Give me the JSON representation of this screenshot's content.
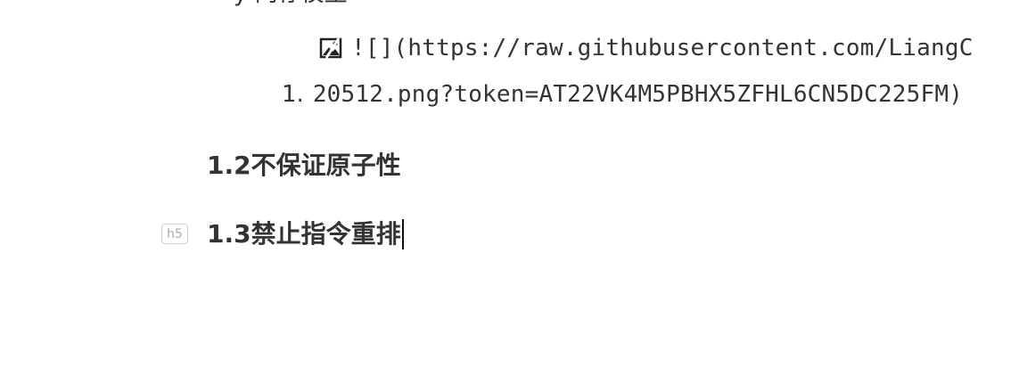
{
  "document": {
    "clipped_line_text": "y    内存模型",
    "image_markdown": "![](https://raw.githubusercontent.com/LiangC",
    "list_item": {
      "marker": "1.",
      "text": "20512.png?token=AT22VK4M5PBHX5ZFHL6CN5DC225FM)"
    },
    "headings": [
      {
        "text": "1.2不保证原子性"
      },
      {
        "text": "1.3禁止指令重排"
      }
    ],
    "active_heading_level_badge": "h5"
  },
  "icons": {
    "broken_image": "broken-image-icon"
  },
  "colors": {
    "text": "#333333",
    "caret": "#111111",
    "badge_border": "#d0d0d0",
    "badge_text": "#aaaaaa",
    "background": "#ffffff"
  }
}
